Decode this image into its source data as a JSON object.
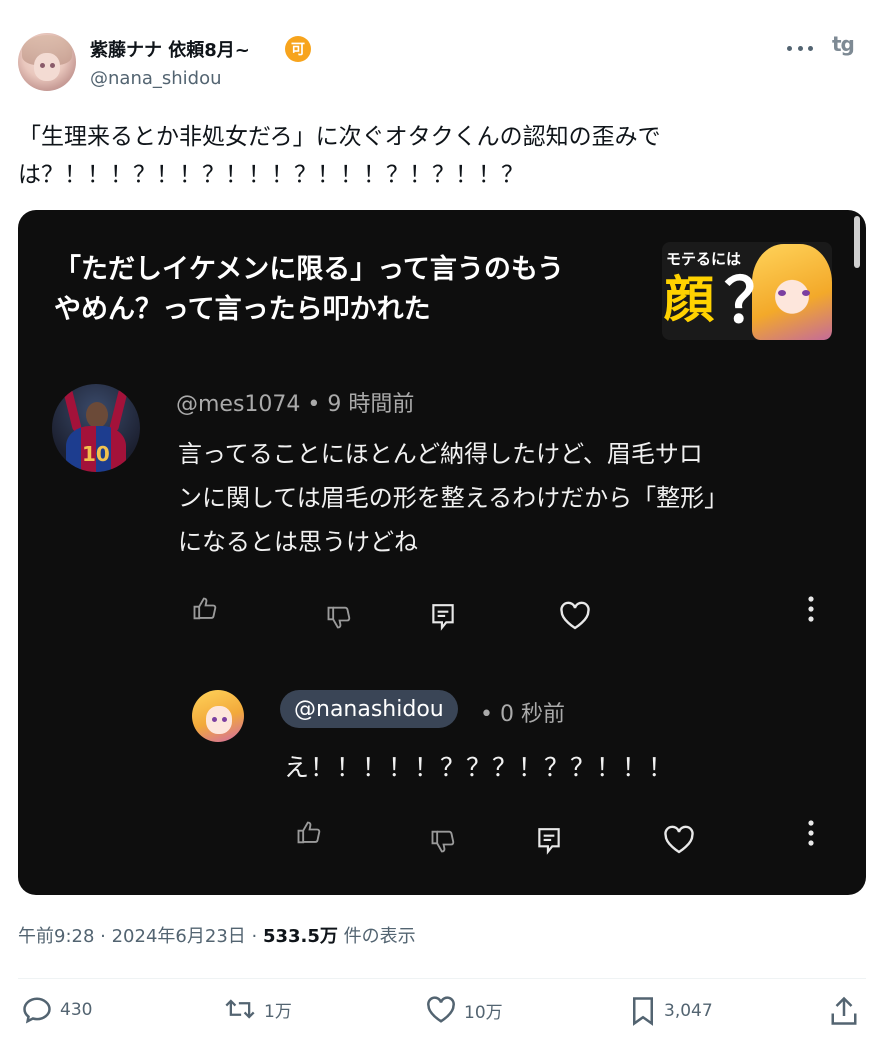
{
  "author": {
    "display_name": "紫藤ナナ 依頼8月~",
    "badge": "可",
    "handle": "@nana_shidou"
  },
  "tweet": {
    "text_line1": "「生理来るとか非処女だろ」に次ぐオタクくんの認知の歪みで",
    "text_line2": "は？！！！？！！？！！！？！！！？！？！！？"
  },
  "card": {
    "video_title_line1": "「ただしイケメンに限る」って言うのもう",
    "video_title_line2": "やめん？って言ったら叩かれた",
    "thumbnail": {
      "small_text": "モテるには",
      "big_text": "顔",
      "question": "？"
    },
    "comment": {
      "handle": "@mes1074",
      "time": "9 時間前",
      "line1": "言ってることにほとんど納得したけど、眉毛サロ",
      "line2": "ンに関しては眉毛の形を整えるわけだから「整形」",
      "line3": "になるとは思うけどね",
      "avatar_number": "10"
    },
    "reply": {
      "handle": "@nanashidou",
      "time": "0 秒前",
      "text": "え！！！！！？？？！？？！！！"
    }
  },
  "meta": {
    "time": "午前9:28",
    "date": "2024年6月23日",
    "views_count": "533.5万",
    "views_label": "件の表示"
  },
  "stats": {
    "replies": "430",
    "retweets": "1万",
    "likes": "10万",
    "bookmarks": "3,047"
  },
  "icons": {
    "more": "more-horizontal-icon",
    "share": "share-icon",
    "brand": "tg-icon",
    "brand_text": "tg"
  }
}
